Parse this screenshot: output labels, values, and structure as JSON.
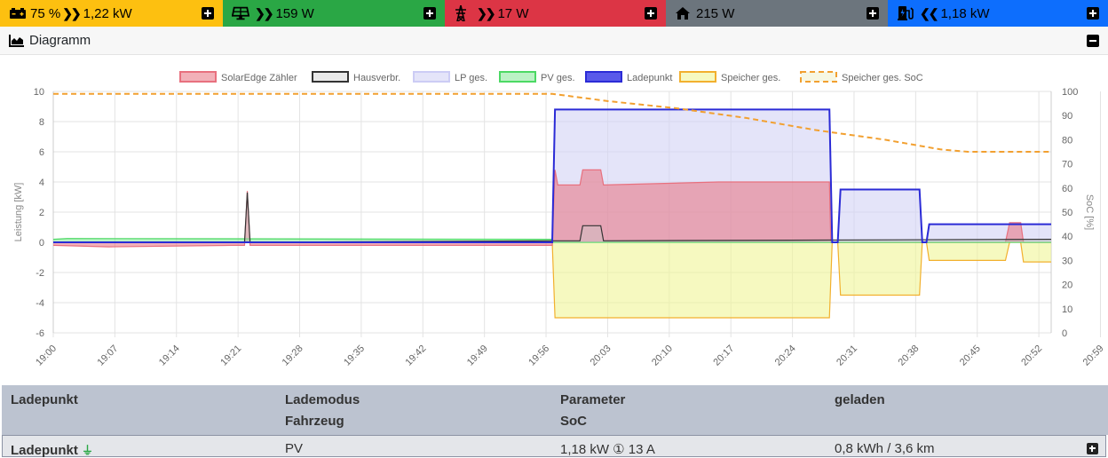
{
  "topbar": {
    "battery": {
      "text": "75 %",
      "value": "1,22 kW",
      "color": "#fdc010",
      "icon": "car-battery-icon",
      "direction": "out"
    },
    "pv": {
      "value": "159 W",
      "color": "#2aa745",
      "icon": "solar-panel-icon"
    },
    "grid": {
      "value": "17 W",
      "color": "#dc3545",
      "icon": "power-tower-icon"
    },
    "house": {
      "value": "215 W",
      "color": "#6c757d",
      "icon": "house-icon"
    },
    "chargepoint": {
      "value": "1,18 kW",
      "color": "#0d6efd",
      "icon": "charging-station-icon",
      "direction": "in"
    }
  },
  "diagram": {
    "title": "Diagramm",
    "icon": "area-chart-icon"
  },
  "chart_data": {
    "type": "area",
    "legend_position": "top",
    "ylabel": "Leistung [kW]",
    "y2label": "SoC [%]",
    "ylim": [
      -6,
      10
    ],
    "y2lim": [
      0,
      100
    ],
    "yticks": [
      "10",
      "8",
      "6",
      "4",
      "2",
      "0",
      "-2",
      "-4",
      "-6"
    ],
    "y2ticks": [
      "100",
      "90",
      "80",
      "70",
      "60",
      "50",
      "40",
      "30",
      "20",
      "10",
      "0"
    ],
    "xticks": [
      "19:00",
      "19:07",
      "19:14",
      "19:21",
      "19:28",
      "19:35",
      "19:42",
      "19:49",
      "19:56",
      "20:03",
      "20:10",
      "20:17",
      "20:24",
      "20:31",
      "20:38",
      "20:45",
      "20:52",
      "20:59"
    ],
    "x_range_minutes": [
      0,
      72
    ],
    "grid": true,
    "series": [
      {
        "name": "SolarEdge Zähler",
        "color": "#e8707e",
        "fill": "rgba(232,112,126,0.55)",
        "points": [
          [
            0,
            -0.2
          ],
          [
            4,
            -0.3
          ],
          [
            13,
            -0.2
          ],
          [
            13.8,
            -0.2
          ],
          [
            14,
            3.4
          ],
          [
            14.2,
            -0.2
          ],
          [
            36,
            -0.2
          ],
          [
            36.2,
            4.8
          ],
          [
            36.4,
            3.8
          ],
          [
            38,
            3.8
          ],
          [
            38.2,
            4.8
          ],
          [
            39.5,
            4.8
          ],
          [
            39.7,
            3.8
          ],
          [
            48,
            4.0
          ],
          [
            56,
            4.0
          ],
          [
            56.1,
            0
          ],
          [
            63,
            0
          ],
          [
            63.1,
            0
          ],
          [
            68.7,
            0
          ],
          [
            69,
            1.3
          ],
          [
            69.8,
            1.3
          ],
          [
            70,
            0
          ],
          [
            72,
            0
          ]
        ]
      },
      {
        "name": "Hausverbr.",
        "color": "#333333",
        "fill": "rgba(200,200,200,0.4)",
        "points": [
          [
            0,
            0
          ],
          [
            13.8,
            0
          ],
          [
            14,
            3.3
          ],
          [
            14.2,
            0
          ],
          [
            36,
            0.1
          ],
          [
            38,
            0.1
          ],
          [
            38.2,
            1.1
          ],
          [
            39.5,
            1.1
          ],
          [
            39.7,
            0.1
          ],
          [
            56,
            0.15
          ],
          [
            72,
            0.2
          ]
        ]
      },
      {
        "name": "LP ges.",
        "color": "#ccccf5",
        "fill": "rgba(210,210,245,0.6)",
        "points": [
          [
            0,
            0
          ],
          [
            36,
            0
          ],
          [
            36.2,
            8.8
          ],
          [
            56,
            8.8
          ],
          [
            56.2,
            0
          ],
          [
            56.6,
            0
          ],
          [
            56.8,
            3.5
          ],
          [
            62.5,
            3.5
          ],
          [
            62.7,
            0
          ],
          [
            63,
            0
          ],
          [
            63.2,
            1.2
          ],
          [
            72,
            1.2
          ]
        ]
      },
      {
        "name": "PV ges.",
        "color": "#4cd964",
        "fill": "rgba(120,230,140,0.5)",
        "points": [
          [
            0,
            0.2
          ],
          [
            1,
            0.25
          ],
          [
            36,
            0.2
          ],
          [
            36.1,
            0
          ],
          [
            72,
            0
          ]
        ]
      },
      {
        "name": "Ladepunkt",
        "color": "#2b2bd6",
        "fill": "rgba(0,0,0,0)",
        "points": [
          [
            0,
            0
          ],
          [
            36,
            0
          ],
          [
            36.2,
            8.8
          ],
          [
            56,
            8.8
          ],
          [
            56.2,
            0
          ],
          [
            56.6,
            0
          ],
          [
            56.8,
            3.5
          ],
          [
            62.5,
            3.5
          ],
          [
            62.7,
            0
          ],
          [
            63,
            0
          ],
          [
            63.2,
            1.2
          ],
          [
            72,
            1.2
          ]
        ]
      },
      {
        "name": "Speicher ges.",
        "color": "#f2b02e",
        "fill": "rgba(240,245,150,0.6)",
        "points": [
          [
            0,
            0
          ],
          [
            36,
            0
          ],
          [
            36.2,
            -5.0
          ],
          [
            56,
            -5.0
          ],
          [
            56.2,
            0
          ],
          [
            56.6,
            0
          ],
          [
            56.8,
            -3.5
          ],
          [
            62.5,
            -3.5
          ],
          [
            62.7,
            0
          ],
          [
            63,
            0
          ],
          [
            63.2,
            -1.2
          ],
          [
            68.7,
            -1.2
          ],
          [
            69,
            0
          ],
          [
            69.8,
            0
          ],
          [
            70,
            -1.3
          ],
          [
            72,
            -1.3
          ]
        ]
      },
      {
        "name": "Speicher ges. SoC",
        "color": "#f2a030",
        "dashed": true,
        "axis": "y2",
        "points": [
          [
            0,
            99
          ],
          [
            36,
            99
          ],
          [
            40,
            96
          ],
          [
            45,
            93
          ],
          [
            50,
            89
          ],
          [
            55,
            84
          ],
          [
            60,
            80
          ],
          [
            64,
            76
          ],
          [
            66,
            75
          ],
          [
            72,
            75
          ]
        ]
      }
    ]
  },
  "table": {
    "headers": {
      "col1": "Ladepunkt",
      "col2a": "Lademodus",
      "col2b": "Fahrzeug",
      "col3a": "Parameter",
      "col3b": "SoC",
      "col4": "geladen"
    },
    "row": {
      "name": "Ladepunkt",
      "plug_icon": "plug-icon",
      "mode": "PV",
      "param": "1,18 kW ① 13 A",
      "charged": "0,8 kWh / 3,6 km"
    }
  }
}
